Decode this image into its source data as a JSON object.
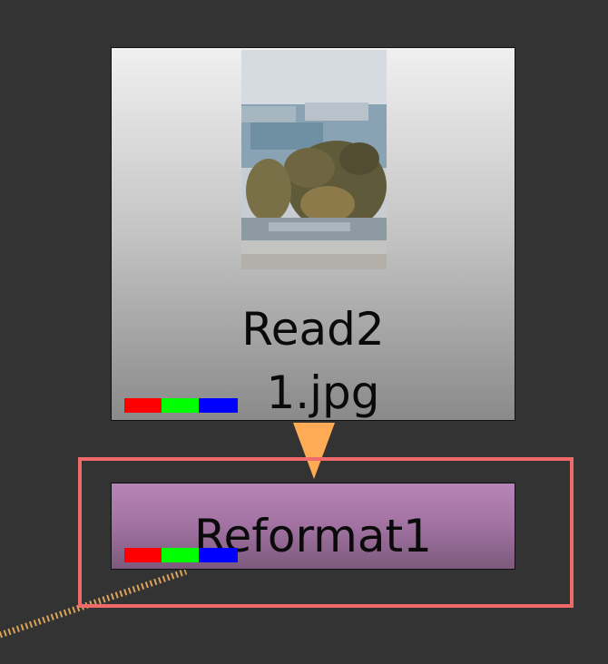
{
  "read_node": {
    "name": "Read2",
    "file": "1.jpg",
    "thumbnail_icon": "landscape-thumbnail"
  },
  "reformat_node": {
    "name": "Reformat1"
  },
  "colors": {
    "canvas_bg": "#333333",
    "read_node_gradient_top": "#f0f0f0",
    "read_node_gradient_bottom": "#8a8a8a",
    "reformat_node_gradient_top": "#b785b7",
    "reformat_node_gradient_bottom": "#7c5a7c",
    "arrow": "#ffaa55",
    "selection_border": "#f06a6a",
    "connector_line": "#d9a35a",
    "channel_red": "#ff0000",
    "channel_green": "#00ff00",
    "channel_blue": "#0000ff"
  },
  "channels": [
    "red-channel-swatch",
    "green-channel-swatch",
    "blue-channel-swatch"
  ]
}
